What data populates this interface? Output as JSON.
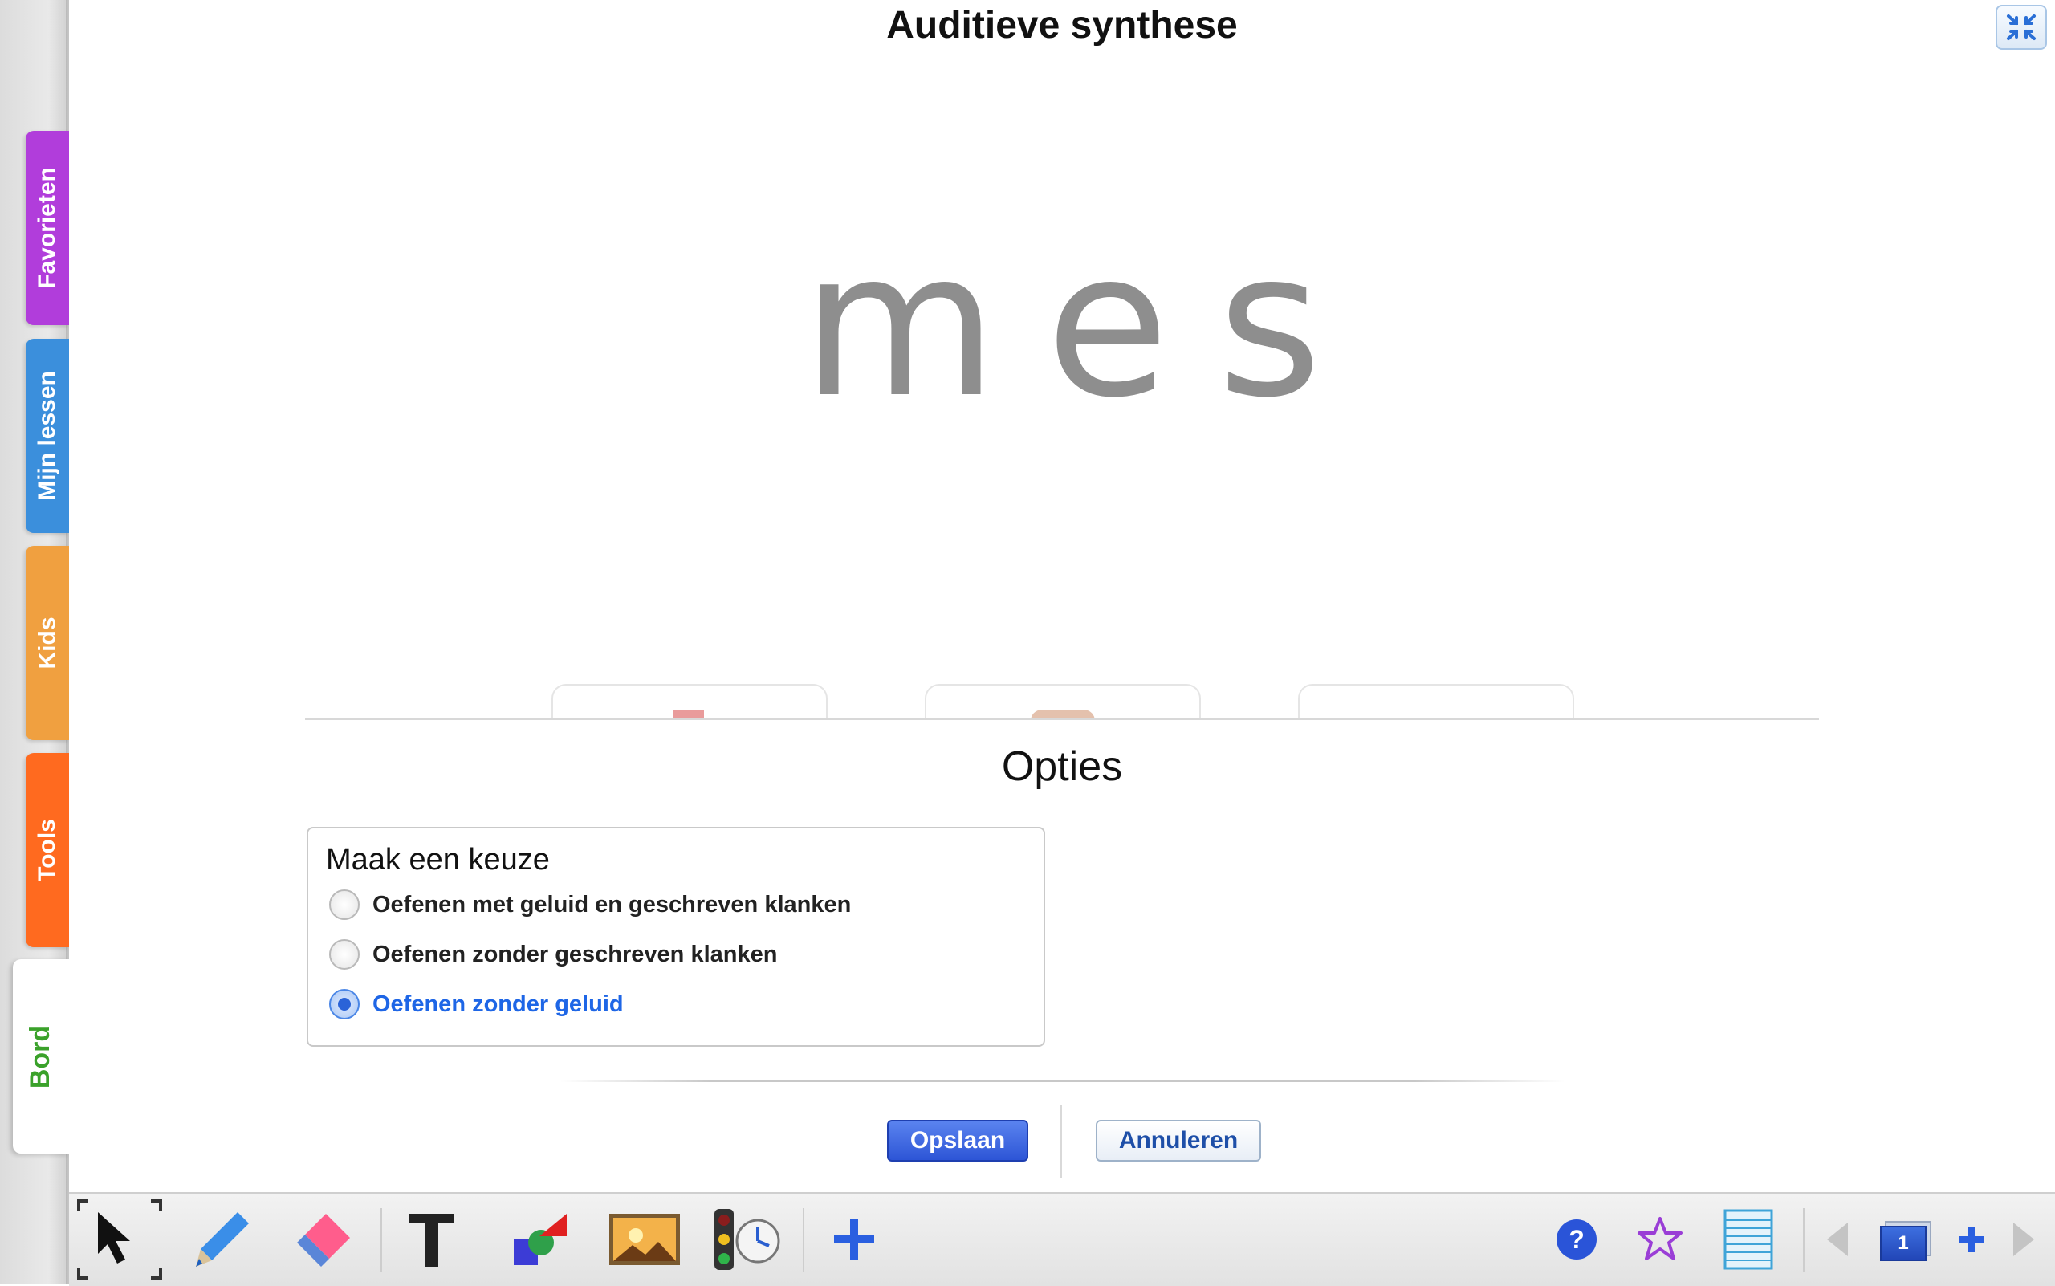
{
  "sidebar": {
    "tabs": [
      {
        "label": "Favorieten"
      },
      {
        "label": "Mijn lessen"
      },
      {
        "label": "Kids"
      },
      {
        "label": "Tools"
      },
      {
        "label": "Bord"
      }
    ]
  },
  "board": {
    "title": "Auditieve synthese",
    "word": "mes"
  },
  "options": {
    "title": "Opties",
    "legend": "Maak een keuze",
    "choices": [
      {
        "label": "Oefenen met geluid en geschreven klanken",
        "selected": false
      },
      {
        "label": "Oefenen zonder geschreven klanken",
        "selected": false
      },
      {
        "label": "Oefenen zonder geluid",
        "selected": true
      }
    ],
    "save_label": "Opslaan",
    "cancel_label": "Annuleren"
  },
  "toolbar": {
    "page_number": "1",
    "icons": [
      "select-icon",
      "pen-icon",
      "eraser-icon",
      "text-icon",
      "shapes-icon",
      "image-icon",
      "traffic-light-timer-icon",
      "add-icon",
      "help-icon",
      "favorite-star-icon",
      "notes-icon",
      "previous-page-icon",
      "page-thumbnail-icon",
      "add-page-icon",
      "next-page-icon"
    ]
  },
  "colors": {
    "favorieten": "#b13ddb",
    "mijn_lessen": "#3b8fdc",
    "kids": "#f0a040",
    "tools": "#ff6a1f",
    "bord": "#3aa12a",
    "accent_blue": "#2d55d6"
  }
}
